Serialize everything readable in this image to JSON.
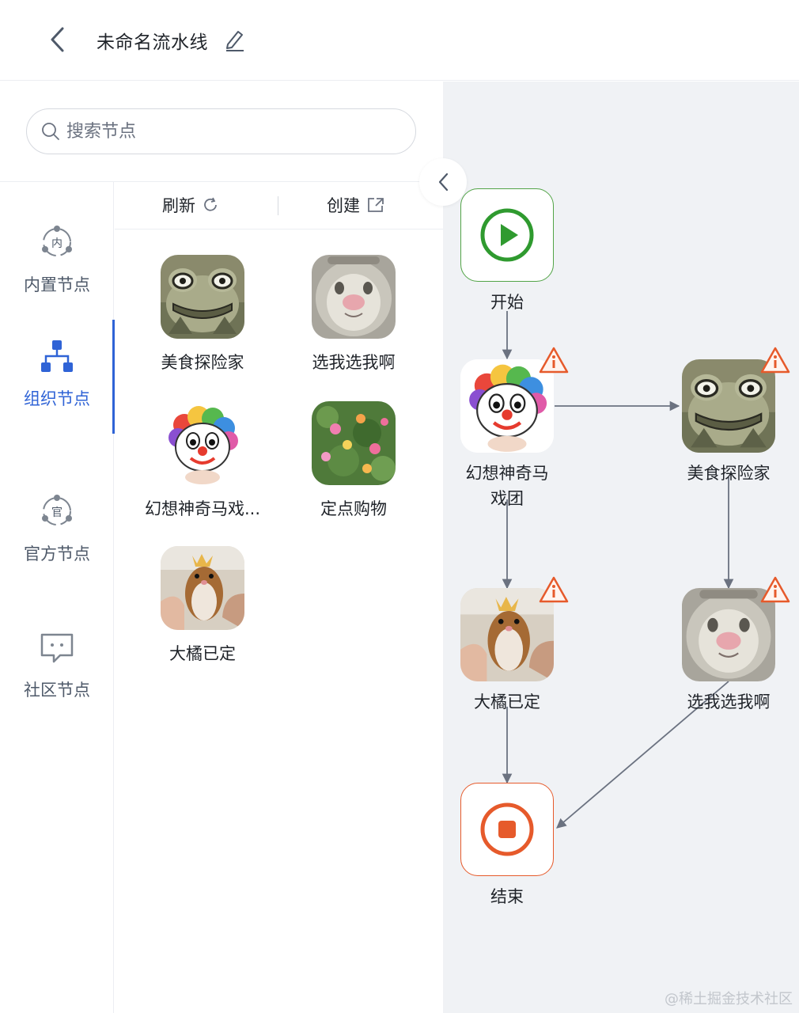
{
  "header": {
    "title": "未命名流水线",
    "back_icon": "chevron-left-icon",
    "edit_icon": "pencil-icon"
  },
  "search": {
    "placeholder": "搜索节点",
    "value": ""
  },
  "categories": [
    {
      "label": "内置节点",
      "icon": "builtin-node-icon",
      "badge": "内"
    },
    {
      "label": "组织节点",
      "icon": "org-tree-icon"
    },
    {
      "label": "官方节点",
      "icon": "official-node-icon",
      "badge": "官"
    },
    {
      "label": "社区节点",
      "icon": "chat-bubble-icon"
    }
  ],
  "active_category": "组织节点",
  "toolbar": {
    "refresh_label": "刷新",
    "create_label": "创建"
  },
  "nodes": [
    {
      "label": "美食探险家",
      "thumb": "frog"
    },
    {
      "label": "选我选我啊",
      "thumb": "cat"
    },
    {
      "label": "幻想神奇马戏...",
      "thumb": "clown"
    },
    {
      "label": "定点购物",
      "thumb": "flowers"
    },
    {
      "label": "大橘已定",
      "thumb": "hamster"
    }
  ],
  "canvas": {
    "start_label": "开始",
    "end_label": "结束",
    "flow_nodes": [
      {
        "line1": "幻想神奇马",
        "line2": "戏团",
        "thumb": "clown",
        "warning": true
      },
      {
        "line1": "美食探险家",
        "line2": "",
        "thumb": "frog",
        "warning": true
      },
      {
        "line1": "大橘已定",
        "line2": "",
        "thumb": "hamster",
        "warning": true
      },
      {
        "line1": "选我选我啊",
        "line2": "",
        "thumb": "cat",
        "warning": true
      }
    ]
  },
  "colors": {
    "accent": "#2f63d6",
    "start": "#52a447",
    "end": "#e65a2b",
    "warning": "#e65a2b",
    "edge": "#6b7280"
  },
  "watermark": "@稀土掘金技术社区"
}
